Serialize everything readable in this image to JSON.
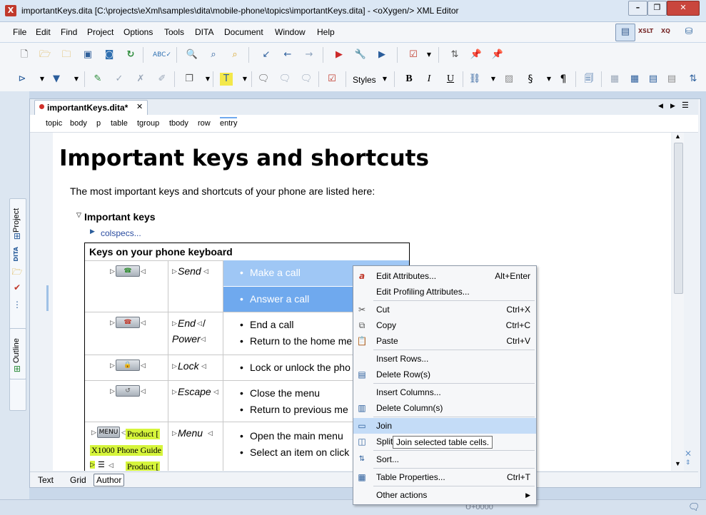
{
  "window": {
    "title": "importantKeys.dita [C:\\projects\\eXml\\samples\\dita\\mobile-phone\\topics\\importantKeys.dita] - <oXygen/> XML Editor",
    "app_icon": "X",
    "minimize": "–",
    "restore": "❐",
    "close": "✕"
  },
  "menubar": [
    "File",
    "Edit",
    "Find",
    "Project",
    "Options",
    "Tools",
    "DITA",
    "Document",
    "Window",
    "Help"
  ],
  "perspectives": [
    "editor-perspective-icon",
    "XSLT",
    "XQ",
    "database-perspective-icon"
  ],
  "toolbar": {
    "styles_label": "Styles",
    "bold": "B",
    "italic": "I",
    "underline": "U",
    "section": "§",
    "pilcrow": "¶"
  },
  "side_tabs": {
    "project": "Project",
    "dita": "DITA",
    "outline": "Outline"
  },
  "editor": {
    "file_tab": "importantKeys.dita*",
    "breadcrumb": [
      "topic",
      "body",
      "p",
      "table",
      "tgroup",
      "tbody",
      "row",
      "entry"
    ],
    "bottom_tabs": [
      "Text",
      "Grid",
      "Author"
    ],
    "active_bottom_tab": "Author"
  },
  "document": {
    "title": "Important keys and shortcuts",
    "intro": "The most important keys and shortcuts of your phone are listed here:",
    "section_title": "Important keys",
    "colspecs": "colspecs...",
    "table_title": "Keys on your phone keyboard",
    "rows": [
      {
        "key": "Send",
        "items": [
          "Make a call",
          "Answer a call"
        ]
      },
      {
        "key": "End/ Power",
        "items": [
          "End a call",
          "Return to the home me"
        ]
      },
      {
        "key": "Lock",
        "items": [
          "Lock or unlock the pho"
        ]
      },
      {
        "key": "Escape",
        "items": [
          "Close the menu",
          "Return to previous me"
        ]
      },
      {
        "key": "Menu",
        "items": [
          "Open the main menu",
          "Select an item on click"
        ]
      }
    ],
    "end_key_parts": [
      "End",
      "/",
      "Power"
    ],
    "product_ref_1": "Product [",
    "product_ref_2": "X1000 Phone Guide",
    "product_ref_3": "Product [",
    "menu_key_label": "MENU"
  },
  "context_menu": {
    "items": [
      {
        "label": "Edit Attributes...",
        "shortcut": "Alt+Enter",
        "icon": "attributes-icon"
      },
      {
        "label": "Edit Profiling Attributes...",
        "shortcut": "",
        "icon": ""
      },
      {
        "label": "Cut",
        "shortcut": "Ctrl+X",
        "icon": "scissors-icon"
      },
      {
        "label": "Copy",
        "shortcut": "Ctrl+C",
        "icon": "copy-icon"
      },
      {
        "label": "Paste",
        "shortcut": "Ctrl+V",
        "icon": "paste-icon"
      },
      {
        "label": "Insert Rows...",
        "shortcut": "",
        "icon": ""
      },
      {
        "label": "Delete Row(s)",
        "shortcut": "",
        "icon": "delete-row-icon"
      },
      {
        "label": "Insert Columns...",
        "shortcut": "",
        "icon": ""
      },
      {
        "label": "Delete Column(s)",
        "shortcut": "",
        "icon": "delete-column-icon"
      },
      {
        "label": "Join",
        "shortcut": "",
        "icon": "join-cells-icon"
      },
      {
        "label": "Split",
        "shortcut": "",
        "icon": "split-cells-icon"
      },
      {
        "label": "Sort...",
        "shortcut": "",
        "icon": "sort-icon"
      },
      {
        "label": "Table Properties...",
        "shortcut": "Ctrl+T",
        "icon": "table-properties-icon"
      },
      {
        "label": "Other actions",
        "shortcut": "",
        "icon": ""
      }
    ],
    "tooltip": "Join selected table cells."
  },
  "statusbar": {
    "text": "U+0000"
  },
  "colors": {
    "highlight": "#9fc7f5",
    "selected_cell": "#6fa9ee",
    "menu_hover": "#c4dcf7",
    "product_ref_bg": "#d6f53b"
  }
}
